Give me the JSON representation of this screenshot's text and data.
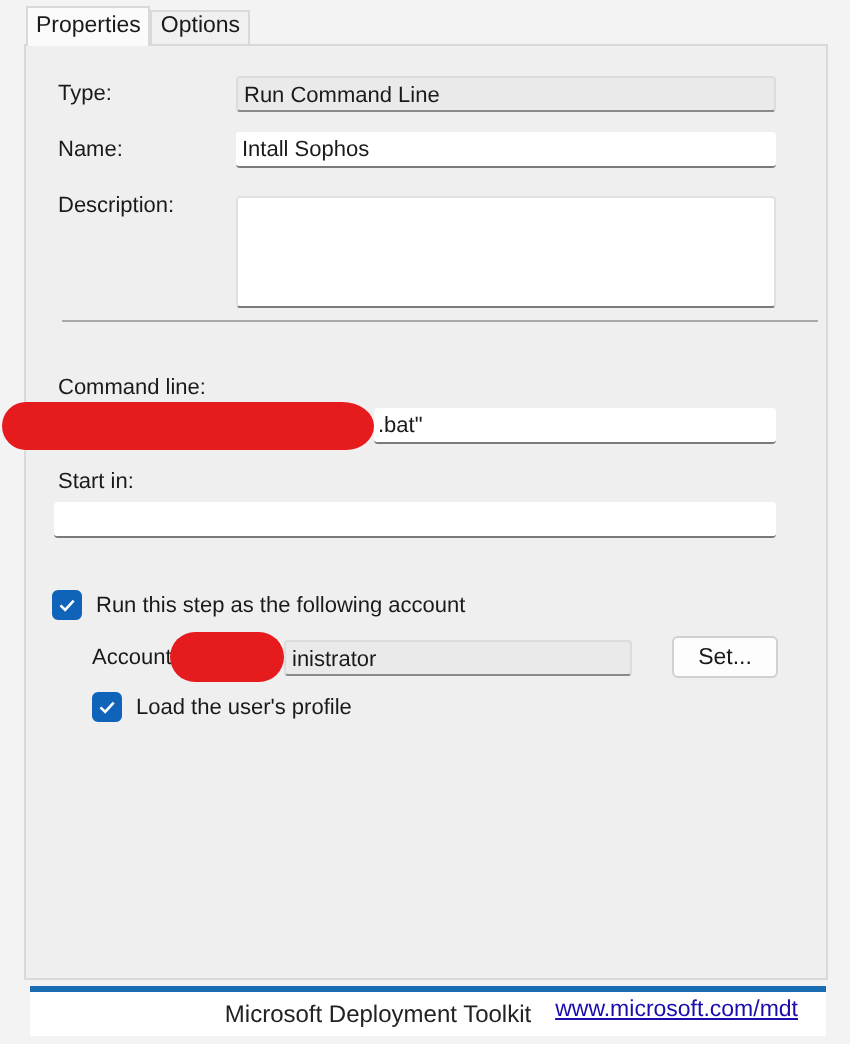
{
  "tabs": [
    {
      "label": "Properties",
      "selected": true
    },
    {
      "label": "Options",
      "selected": false
    }
  ],
  "type": {
    "label": "Type:",
    "value": "Run Command Line"
  },
  "name": {
    "label": "Name:",
    "value": "Intall Sophos"
  },
  "description": {
    "label": "Description:"
  },
  "command_line": {
    "label": "Command line:",
    "value": ".bat\"",
    "redacted": true
  },
  "start_in": {
    "label": "Start in:"
  },
  "run_as": {
    "label": "Run this step as the following account",
    "checked": true
  },
  "account": {
    "label": "Account",
    "value": "inistrator",
    "redacted": true,
    "button": "Set..."
  },
  "load_profile": {
    "label": "Load the user's profile",
    "checked": true
  },
  "footer": {
    "product": "Microsoft Deployment Toolkit",
    "link": "www.microsoft.com/mdt"
  }
}
